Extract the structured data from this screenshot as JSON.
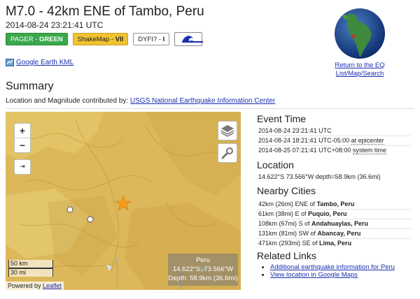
{
  "header": {
    "title": "M7.0 - 42km ENE of Tambo, Peru",
    "datetime": "2014-08-24 23:21:41 UTC"
  },
  "badges": {
    "pager_label": "PAGER - ",
    "pager_level": "GREEN",
    "shakemap_label": "ShakeMap - ",
    "shakemap_level": "VII",
    "dyfi_label": "DYFI? - ",
    "dyfi_level": "I",
    "tsunami_icon": "tsunami-icon"
  },
  "kml": {
    "label": "Google Earth KML",
    "icon": "google-earth-icon"
  },
  "globe": {
    "caption": "Return to the EQ List/Map/Search",
    "icon": "globe-icon"
  },
  "summary": {
    "heading": "Summary",
    "contrib_prefix": "Location and Magnitude contributed by: ",
    "contrib_link": "USGS National Earthquake Information Center"
  },
  "map": {
    "zoom_in": "+",
    "zoom_out": "−",
    "fullscreen": "⇥",
    "scale_km": "50 km",
    "scale_mi": "30 mi",
    "powered_by": "Powered by ",
    "leaflet": "Leaflet",
    "info_line1": "Peru",
    "info_line2": "14.622°S, 73.566°W",
    "info_line3": "Depth: 58.9km (36.6mi)"
  },
  "event_time": {
    "heading": "Event Time",
    "utc": "2014-08-24 23:21:41 UTC",
    "epicenter_time": "2014-08-24 18:21:41 UTC-05:00 ",
    "epicenter_label": "at epicenter",
    "system_time": "2014-08-25 07:21:41 UTC+08:00 ",
    "system_label": "system time"
  },
  "location": {
    "heading": "Location",
    "value": "14.622°S 73.566°W depth=58.9km (36.6mi)"
  },
  "nearby": {
    "heading": "Nearby Cities",
    "cities": [
      {
        "dist": "42km (26mi) ENE of ",
        "name": "Tambo, Peru"
      },
      {
        "dist": "61km (38mi) E of ",
        "name": "Puquio, Peru"
      },
      {
        "dist": "108km (67mi) S of ",
        "name": "Andahuaylas, Peru"
      },
      {
        "dist": "131km (81mi) SW of ",
        "name": "Abancay, Peru"
      },
      {
        "dist": "471km (293mi) SE of ",
        "name": "Lima, Peru"
      }
    ]
  },
  "related": {
    "heading": "Related Links",
    "links": [
      "Additional earthquake information for Peru",
      "View location in Google Maps"
    ]
  }
}
